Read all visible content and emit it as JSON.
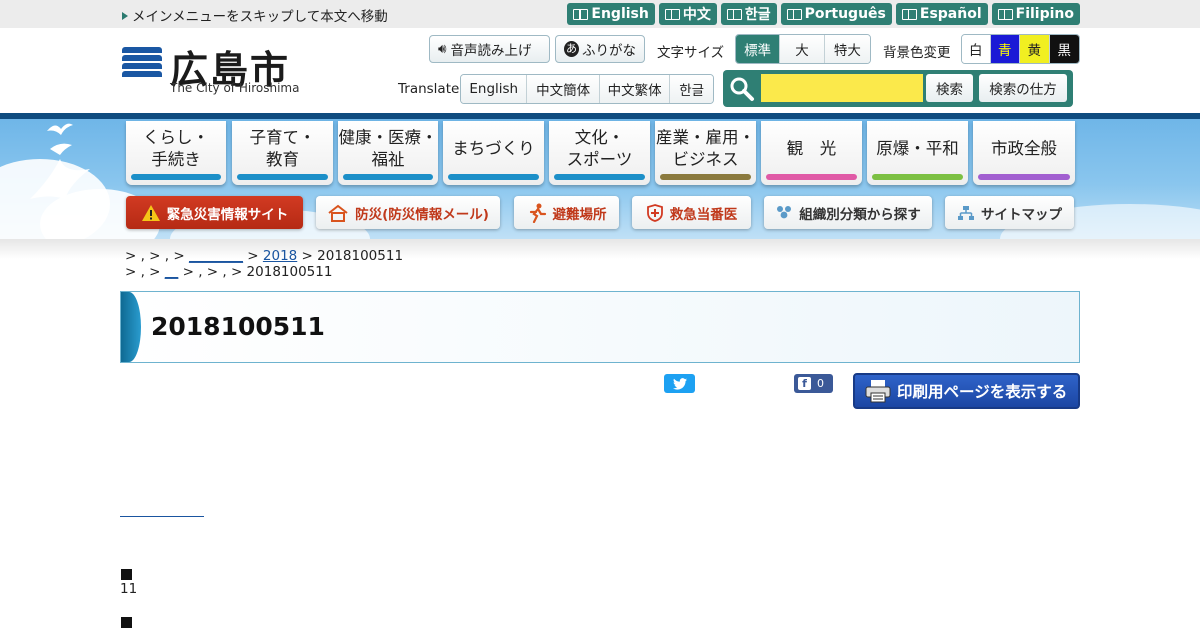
{
  "topbar": {
    "skip_link": "メインメニューをスキップして本文へ移動",
    "languages": [
      "English",
      "中文",
      "한글",
      "Português",
      "Español",
      "Filipino"
    ]
  },
  "header": {
    "logo_title": "広島市",
    "logo_subtitle": "The City of Hiroshima",
    "voice_button": "音声読み上げ",
    "furigana_button": "ふりがな",
    "font_size_label": "文字サイズ",
    "font_sizes": [
      "標準",
      "大",
      "特大"
    ],
    "font_size_selected": "標準",
    "bgcolor_label": "背景色変更",
    "bgcolors": [
      "白",
      "青",
      "黄",
      "黒"
    ],
    "translate_label": "Translate",
    "translate_options": [
      "English",
      "中文簡体",
      "中文繁体",
      "한글"
    ],
    "search_placeholder": "",
    "search_button": "検索",
    "search_help_button": "検索の仕方"
  },
  "nav": {
    "items": [
      {
        "label_1": "くらし・",
        "label_2": "手続き",
        "color": "#1c8fc8"
      },
      {
        "label_1": "子育て・",
        "label_2": "教育",
        "color": "#1c8fc8"
      },
      {
        "label_1": "健康・医療・",
        "label_2": "福祉",
        "color": "#1c8fc8"
      },
      {
        "label_1": "まちづくり",
        "label_2": "",
        "color": "#1c8fc8"
      },
      {
        "label_1": "文化・",
        "label_2": "スポーツ",
        "color": "#1c8fc8"
      },
      {
        "label_1": "産業・雇用・",
        "label_2": "ビジネス",
        "color": "#8b7a3e"
      },
      {
        "label_1": "観　光",
        "label_2": "",
        "color": "#e05aa6"
      },
      {
        "label_1": "原爆・平和",
        "label_2": "",
        "color": "#7cc043"
      },
      {
        "label_1": "市政全般",
        "label_2": "",
        "color": "#a25fd0"
      }
    ],
    "sub": [
      "緊急災害情報サイト",
      "防災(防災情報メール)",
      "避難場所",
      "救急当番医",
      "組織別分類から探す",
      "サイトマップ"
    ]
  },
  "breadcrumbs": {
    "row1_prefix": "> , > , > ",
    "row1_link_blank": "________",
    "row1_sep": " > ",
    "row1_link_year": "2018",
    "row1_current": " > 2018100511",
    "row2_prefix": "> , > ",
    "row2_link_blank": "__",
    "row2_rest": " > , > , > 2018100511"
  },
  "page": {
    "title": "2018100511",
    "fb_count": "0",
    "print_button": "印刷用ページを表示する",
    "item_number": "11"
  }
}
